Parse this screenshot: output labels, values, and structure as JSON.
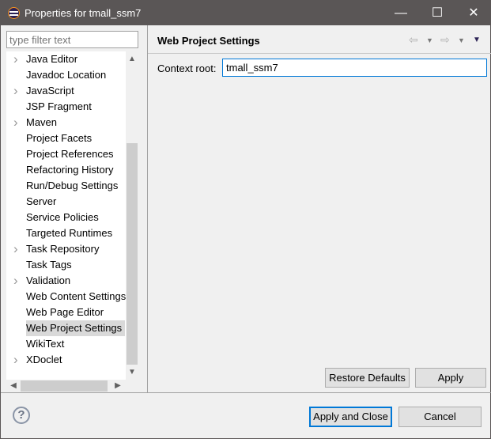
{
  "window": {
    "title": "Properties for tmall_ssm7",
    "minimize": "—",
    "maximize": "☐",
    "close": "✕"
  },
  "filter": {
    "placeholder": "type filter text"
  },
  "tree": {
    "items": [
      {
        "label": "Java Editor",
        "expandable": true
      },
      {
        "label": "Javadoc Location",
        "expandable": false
      },
      {
        "label": "JavaScript",
        "expandable": true
      },
      {
        "label": "JSP Fragment",
        "expandable": false
      },
      {
        "label": "Maven",
        "expandable": true
      },
      {
        "label": "Project Facets",
        "expandable": false
      },
      {
        "label": "Project References",
        "expandable": false
      },
      {
        "label": "Refactoring History",
        "expandable": false
      },
      {
        "label": "Run/Debug Settings",
        "expandable": false
      },
      {
        "label": "Server",
        "expandable": false
      },
      {
        "label": "Service Policies",
        "expandable": false
      },
      {
        "label": "Targeted Runtimes",
        "expandable": false
      },
      {
        "label": "Task Repository",
        "expandable": true
      },
      {
        "label": "Task Tags",
        "expandable": false
      },
      {
        "label": "Validation",
        "expandable": true
      },
      {
        "label": "Web Content Settings",
        "expandable": false
      },
      {
        "label": "Web Page Editor",
        "expandable": false
      },
      {
        "label": "Web Project Settings",
        "expandable": false,
        "selected": true
      },
      {
        "label": "WikiText",
        "expandable": false
      },
      {
        "label": "XDoclet",
        "expandable": true
      }
    ]
  },
  "page": {
    "title": "Web Project Settings",
    "context_root_label": "Context root:",
    "context_root_value": "tmall_ssm7"
  },
  "buttons": {
    "restore_defaults": "Restore Defaults",
    "apply": "Apply",
    "apply_and_close": "Apply and Close",
    "cancel": "Cancel",
    "help": "?"
  },
  "colors": {
    "accent": "#0078d7",
    "titlebar": "#5a5656",
    "selection": "#d9d9d9"
  }
}
